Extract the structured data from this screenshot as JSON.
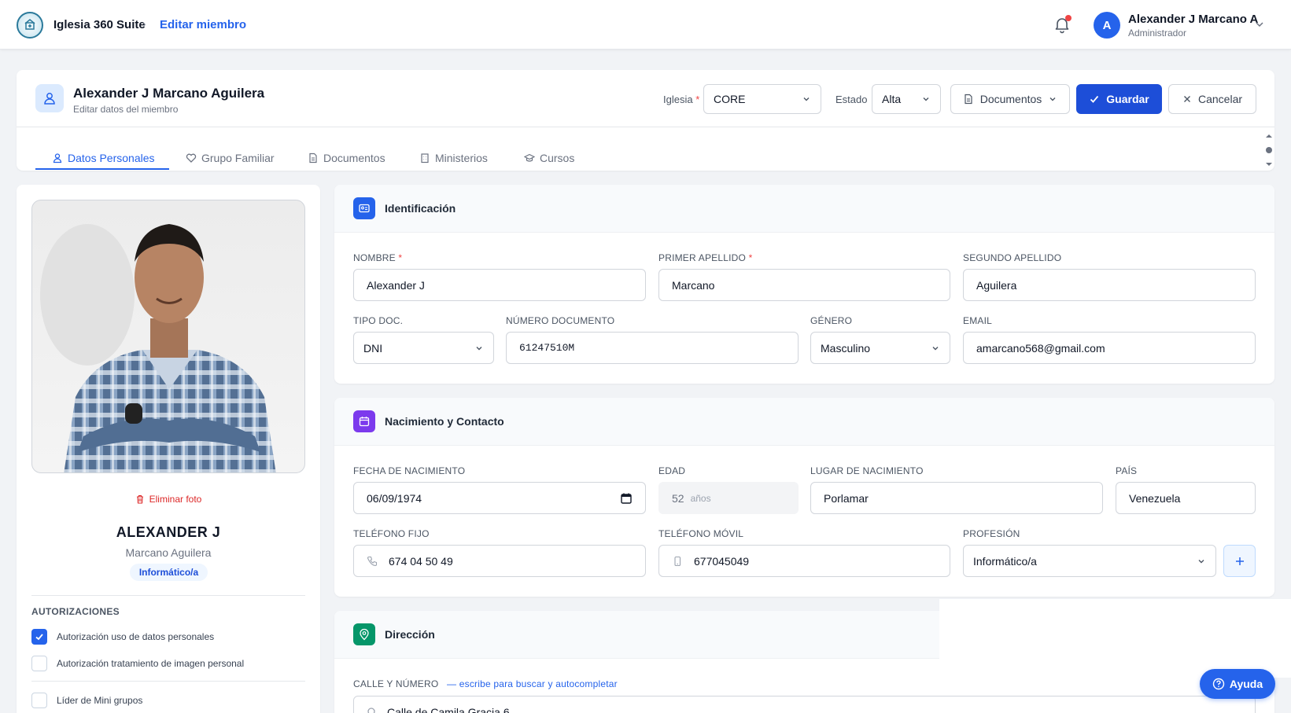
{
  "topbar": {
    "app_name": "Iglesia 360 Suite",
    "breadcrumb_current": "Editar miembro",
    "user": {
      "initial": "A",
      "name": "Alexander J Marcano A",
      "role": "Administrador"
    }
  },
  "header": {
    "member_name": "Alexander J Marcano Aguilera",
    "member_subtitle": "Editar datos del miembro",
    "iglesia_label": "Iglesia",
    "iglesia_value": "CORE",
    "estado_label": "Estado",
    "estado_value": "Alta",
    "documentos_button": "Documentos",
    "guardar_button": "Guardar",
    "cancelar_button": "Cancelar"
  },
  "tabs": [
    {
      "label": "Datos Personales",
      "icon": "user-icon",
      "active": true
    },
    {
      "label": "Grupo Familiar",
      "icon": "heart-icon",
      "active": false
    },
    {
      "label": "Documentos",
      "icon": "document-icon",
      "active": false
    },
    {
      "label": "Ministerios",
      "icon": "building-icon",
      "active": false
    },
    {
      "label": "Cursos",
      "icon": "graduation-icon",
      "active": false
    }
  ],
  "profile": {
    "delete_photo": "Eliminar foto",
    "display_first": "ALEXANDER J",
    "display_last": "Marcano Aguilera",
    "profession_badge": "Informático/a",
    "authorizations_title": "AUTORIZACIONES",
    "checkboxes": [
      {
        "label": "Autorización uso de datos personales",
        "checked": true
      },
      {
        "label": "Autorización tratamiento de imagen personal",
        "checked": false
      },
      {
        "label": "Líder de Mini grupos",
        "checked": false
      }
    ]
  },
  "identificacion": {
    "title": "Identificación",
    "nombre_label": "NOMBRE",
    "nombre_value": "Alexander J",
    "primer_apellido_label": "PRIMER APELLIDO",
    "primer_apellido_value": "Marcano",
    "segundo_apellido_label": "SEGUNDO APELLIDO",
    "segundo_apellido_value": "Aguilera",
    "tipo_doc_label": "TIPO DOC.",
    "tipo_doc_value": "DNI",
    "numero_doc_label": "NÚMERO DOCUMENTO",
    "numero_doc_value": "61247510M",
    "genero_label": "GÉNERO",
    "genero_value": "Masculino",
    "email_label": "EMAIL",
    "email_value": "amarcano568@gmail.com"
  },
  "nacimiento": {
    "title": "Nacimiento y Contacto",
    "fecha_label": "FECHA DE NACIMIENTO",
    "fecha_value": "06/09/1974",
    "edad_label": "EDAD",
    "edad_value": "52",
    "edad_unit": "años",
    "lugar_label": "LUGAR DE NACIMIENTO",
    "lugar_value": "Porlamar",
    "pais_label": "PAÍS",
    "pais_value": "Venezuela",
    "tel_fijo_label": "TELÉFONO FIJO",
    "tel_fijo_value": "674 04 50 49",
    "tel_movil_label": "TELÉFONO MÓVIL",
    "tel_movil_value": "677045049",
    "profesion_label": "PROFESIÓN",
    "profesion_value": "Informático/a"
  },
  "direccion": {
    "title": "Dirección",
    "calle_label": "CALLE Y NÚMERO",
    "calle_hint": "— escribe para buscar y autocompletar",
    "calle_value": "Calle de Camila Gracia 6"
  },
  "help_button": "Ayuda",
  "colors": {
    "primary": "#1d4ed8",
    "identificacion_icon": "#2563eb",
    "nacimiento_icon": "#7c3aed",
    "direccion_icon": "#059669",
    "danger": "#dc2626"
  }
}
